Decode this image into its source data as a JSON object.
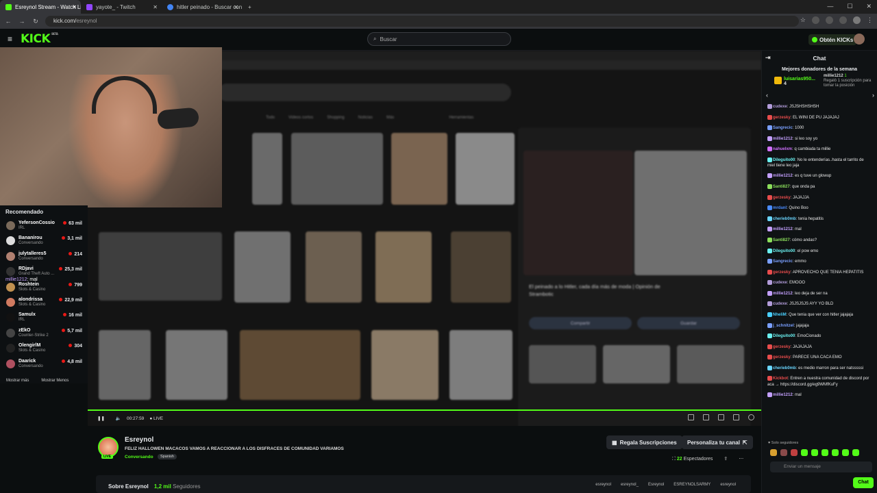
{
  "browser": {
    "tabs": [
      {
        "label": "Esreynol Stream - Watch Live o",
        "color": "#53fc18"
      },
      {
        "label": "yayote_ - Twitch",
        "color": "#9146ff"
      },
      {
        "label": "hitler peinado - Buscar con Goo",
        "color": "#4285f4"
      }
    ],
    "url_host": "kick.com/",
    "url_path": "esreynol"
  },
  "kick": {
    "search_placeholder": "Buscar",
    "get_kicks": "Obtén KICKs"
  },
  "sidebar": {
    "header": "Recomendado",
    "items": [
      {
        "name": "YefersonCossio",
        "category": "IRL",
        "viewers": "63 mil",
        "color": "#7a6a5a"
      },
      {
        "name": "Bananirou",
        "category": "Conversando",
        "viewers": "3,1 mil",
        "color": "#ddd"
      },
      {
        "name": "julytalleres5",
        "category": "Conversando",
        "viewers": "214",
        "color": "#b08070"
      },
      {
        "name": "RDjavi",
        "category": "Grand Theft Auto ...",
        "viewers": "25,3 mil",
        "color": "#333"
      },
      {
        "name": "Roshtein",
        "category": "Slots & Casino",
        "viewers": "799",
        "color": "#c09050"
      },
      {
        "name": "alondrissa",
        "category": "Slots & Casino",
        "viewers": "22,9 mil",
        "color": "#d07a60"
      },
      {
        "name": "Samulx",
        "category": "IRL",
        "viewers": "16 mil",
        "color": "#111"
      },
      {
        "name": "zEkO",
        "category": "Counter-Strike 2",
        "viewers": "5,7 mil",
        "color": "#444"
      },
      {
        "name": "OlengirlM",
        "category": "Slots & Casino",
        "viewers": "304",
        "color": "#222"
      },
      {
        "name": "Daarick",
        "category": "Conversando",
        "viewers": "4,8 mil",
        "color": "#b05060"
      }
    ],
    "show_more": "Mostrar más",
    "show_less": "Mostrar Menos"
  },
  "overlay_chat": {
    "user": "millie1212",
    "text": ": mal"
  },
  "player": {
    "time": "00:27:59",
    "live": "LIVE",
    "progress_pct": 100
  },
  "channel": {
    "name": "Esreynol",
    "title": "FELIZ HALLOWEN MACACOS VAMOS A REACCIONAR A LOS DISFRACES DE COMUNIDAD VARIAMOS",
    "category": "Conversando",
    "tag": "Spanish",
    "gift_subs": "Regala Suscripciones",
    "customize": "Personaliza tu canal",
    "viewers_count": "22",
    "viewers_label": "Espectadores",
    "about": "Sobre Esreynol",
    "followers_count": "1,2 mil",
    "followers_label": "Seguidores",
    "socials": [
      "esreynol",
      "esreynol_",
      "Esreynol",
      "ESREYNOLSARMY",
      "esreynol"
    ]
  },
  "chat": {
    "header": "Chat",
    "donors_title": "Mejores donadores de la semana",
    "donor1_name": "luisarias950...",
    "donor1_count": "4",
    "donor2_name": "millie1212",
    "donor2_count": "1",
    "donor2_text": "Regaló 1 suscripción para tomar la posición",
    "messages": [
      {
        "user": "cudexe",
        "color": "#b39ddb",
        "text": ": JSJSHSHSHSH"
      },
      {
        "user": "gerzesky",
        "color": "#e84c4c",
        "text": ": EL WINI DE PU JAJAJAJ"
      },
      {
        "user": "Sangrecic",
        "color": "#7aa0ff",
        "text": ": 1000"
      },
      {
        "user": "millie1212",
        "color": "#c4a0ff",
        "text": ": si leo soy yo"
      },
      {
        "user": "nahuelxm",
        "color": "#d070ff",
        "text": ": q cambiada ta millie"
      },
      {
        "user": "Dileguito00",
        "color": "#6af0f0",
        "text": ": No le entenderías..hasta el tarrito de miel tiene leo jaja"
      },
      {
        "user": "millie1212",
        "color": "#c4a0ff",
        "text": ": es q tuve un glowup"
      },
      {
        "user": "Santi827",
        "color": "#8bde5b",
        "text": ": que onda pa"
      },
      {
        "user": "gerzesky",
        "color": "#e84c4c",
        "text": ": JAJAJJA"
      },
      {
        "user": "mrdanl",
        "color": "#4a8cff",
        "text": ": Quino Boo"
      },
      {
        "user": "cherieb0mb",
        "color": "#6ad6ff",
        "text": ": tenia hepatitis"
      },
      {
        "user": "millie1212",
        "color": "#c4a0ff",
        "text": ": mal"
      },
      {
        "user": "Santi827",
        "color": "#8bde5b",
        "text": ": cómo andas?"
      },
      {
        "user": "Dileguito00",
        "color": "#6af0f0",
        "text": ": el pow emo"
      },
      {
        "user": "Sangrecic",
        "color": "#7aa0ff",
        "text": ": emmo"
      },
      {
        "user": "gerzesky",
        "color": "#e84c4c",
        "text": ": APROVECHO QUE TENIA HEPATITIS"
      },
      {
        "user": "cudexe",
        "color": "#b39ddb",
        "text": ": EMOOO"
      },
      {
        "user": "millie1212",
        "color": "#c4a0ff",
        "text": ": leo deja de ser na"
      },
      {
        "user": "cudexe",
        "color": "#b39ddb",
        "text": ": JSJSJSJS AYY YO BLD"
      },
      {
        "user": "NheliM",
        "color": "#4ad0ff",
        "text": ": Que tenia que ver con hitler jajajaja"
      },
      {
        "user": "j_schnitzel",
        "color": "#7aa0ff",
        "text": ": jajajaja"
      },
      {
        "user": "Dileguito00",
        "color": "#6af0f0",
        "text": ": EmoCionado"
      },
      {
        "user": "gerzesky",
        "color": "#e84c4c",
        "text": ": JAJAJAJA"
      },
      {
        "user": "gerzesky",
        "color": "#e84c4c",
        "text": ": PARECE UNA CACA EMO"
      },
      {
        "user": "cherieb0mb",
        "color": "#6ad6ff",
        "text": ": es medio marron para ser natsssssi"
      },
      {
        "user": "Kickbot",
        "color": "#e84c4c",
        "text": ": Entren a nuestra comunidad de discord por aca → https://discord.gg/eg9WMfKuFy"
      },
      {
        "user": "millie1212",
        "color": "#c4a0ff",
        "text": ": mal"
      }
    ],
    "followers_only": "Solo seguidores",
    "input_placeholder": "Enviar un mensaje",
    "send": "Chat"
  }
}
